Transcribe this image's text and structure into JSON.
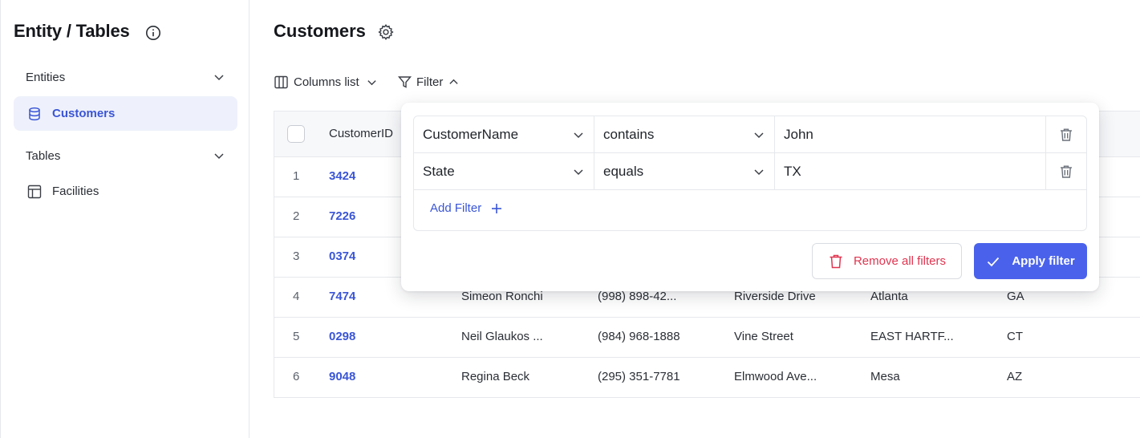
{
  "sidebar": {
    "title": "Entity / Tables",
    "sections": [
      {
        "label": "Entities",
        "items": [
          {
            "label": "Customers",
            "icon": "database-icon",
            "active": true
          }
        ]
      },
      {
        "label": "Tables",
        "items": [
          {
            "label": "Facilities",
            "icon": "table-icon",
            "active": false
          }
        ]
      }
    ]
  },
  "main": {
    "title": "Customers",
    "toolbar": {
      "columns_label": "Columns list",
      "filter_label": "Filter"
    },
    "table": {
      "header": {
        "customer_id": "CustomerID"
      },
      "rows": [
        {
          "num": "1",
          "id": "3424",
          "name": "",
          "phone": "",
          "street": "",
          "city": "",
          "state": ""
        },
        {
          "num": "2",
          "id": "7226",
          "name": "",
          "phone": "",
          "street": "",
          "city": "",
          "state": ""
        },
        {
          "num": "3",
          "id": "0374",
          "name": "",
          "phone": "",
          "street": "",
          "city": "",
          "state": ""
        },
        {
          "num": "4",
          "id": "7474",
          "name": "Simeon Ronchi",
          "phone": "(998) 898-42...",
          "street": "Riverside Drive",
          "city": "Atlanta",
          "state": "GA"
        },
        {
          "num": "5",
          "id": "0298",
          "name": "Neil Glaukos ...",
          "phone": "(984) 968-1888",
          "street": "Vine Street",
          "city": "EAST HARTF...",
          "state": "CT"
        },
        {
          "num": "6",
          "id": "9048",
          "name": "Regina Beck",
          "phone": "(295) 351-7781",
          "street": "Elmwood Ave...",
          "city": "Mesa",
          "state": "AZ"
        }
      ]
    }
  },
  "filter_panel": {
    "filters": [
      {
        "field": "CustomerName",
        "operator": "contains",
        "value": "John"
      },
      {
        "field": "State",
        "operator": "equals",
        "value": "TX"
      }
    ],
    "add_filter_label": "Add Filter",
    "remove_all_label": "Remove all filters",
    "apply_label": "Apply filter"
  },
  "colors": {
    "accent": "#4a62eb",
    "link": "#3a55d6",
    "danger": "#e0344f",
    "active_bg": "#eef1fb"
  }
}
